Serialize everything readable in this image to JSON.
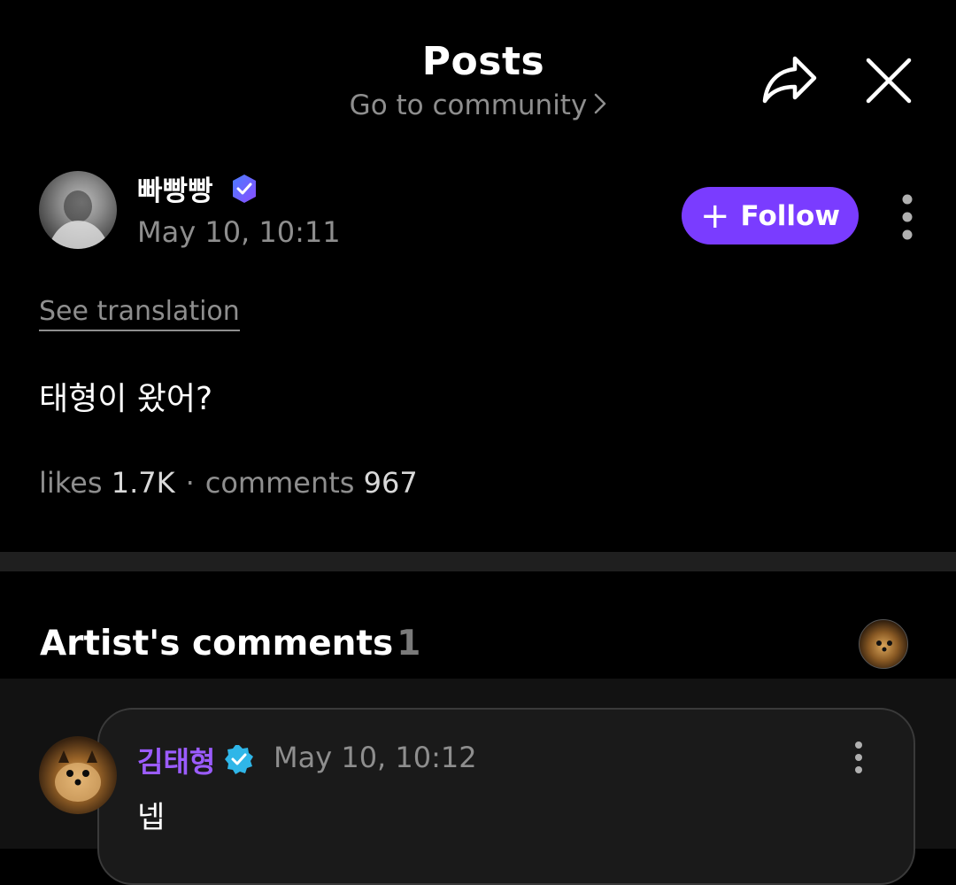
{
  "header": {
    "title": "Posts",
    "community_link": "Go to community",
    "share_icon": "share-icon",
    "close_icon": "close-icon"
  },
  "post": {
    "author": "빠빵빵",
    "date": "May 10, 10:11",
    "follow_label": "Follow",
    "see_translation": "See translation",
    "body": "태형이 왔어?",
    "likes_label": "likes",
    "likes_value": "1.7K",
    "comments_label": "comments",
    "comments_value": "967"
  },
  "artist_comments": {
    "title": "Artist's comments",
    "count": "1",
    "items": [
      {
        "author": "김태형",
        "date": "May 10, 10:12",
        "text": "넵"
      }
    ]
  },
  "colors": {
    "accent": "#7a3cff",
    "artist_name": "#9b5cff",
    "verified_blue": "#2fb6e8",
    "background": "#000000"
  }
}
